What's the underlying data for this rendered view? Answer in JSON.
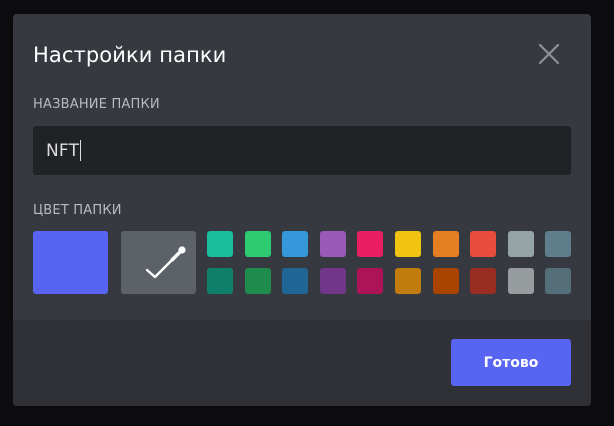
{
  "modal": {
    "title": "Настройки папки",
    "close_icon": "close-icon"
  },
  "name_section": {
    "label": "НАЗВАНИЕ ПАПКИ",
    "value": "NFT"
  },
  "color_section": {
    "label": "ЦВЕТ ПАПКИ",
    "selected_color": "#5865f2",
    "custom_picker_icon": "eyedropper-icon",
    "swatches_top": [
      "#1abc9c",
      "#2ecc71",
      "#3498db",
      "#9b59b6",
      "#e91e63",
      "#f1c40f",
      "#e67e22",
      "#e74c3c",
      "#95a5a6",
      "#607d8b"
    ],
    "swatches_bottom": [
      "#11806a",
      "#1f8b4c",
      "#206694",
      "#71368a",
      "#ad1457",
      "#c27c0e",
      "#a84300",
      "#992d22",
      "#979c9f",
      "#546e7a"
    ]
  },
  "footer": {
    "done_label": "Готово"
  },
  "colors": {
    "accent": "#5865f2",
    "modal_bg": "#36393f",
    "footer_bg": "#2f3136",
    "input_bg": "#202225"
  }
}
